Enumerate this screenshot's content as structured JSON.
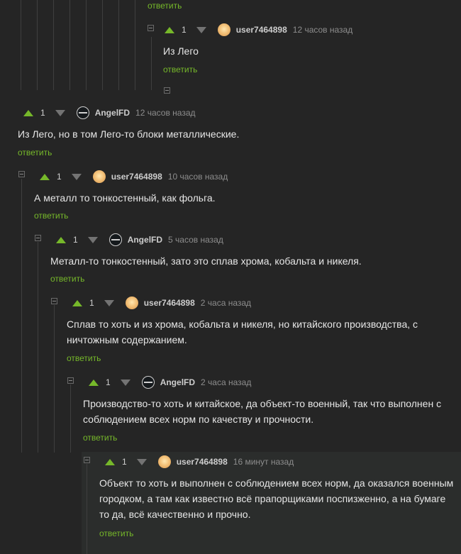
{
  "comments": [
    {
      "reply": "ответить"
    },
    {
      "score": "1",
      "user": "user7464898",
      "time": "12 часов назад",
      "text": "Из Лего",
      "reply": "ответить"
    },
    {
      "score": "1",
      "user": "AngelFD",
      "time": "12 часов назад",
      "text": "Из Лего, но в том Лего-то блоки металлические.",
      "reply": "ответить"
    },
    {
      "score": "1",
      "user": "user7464898",
      "time": "10 часов назад",
      "text": "А металл то тонкостенный, как фольга.",
      "reply": "ответить"
    },
    {
      "score": "1",
      "user": "AngelFD",
      "time": "5 часов назад",
      "text": "Металл-то тонкостенный, зато это сплав хрома, кобальта и никеля.",
      "reply": "ответить"
    },
    {
      "score": "1",
      "user": "user7464898",
      "time": "2 часа назад",
      "text_lines": [
        "Сплав то хоть и из хрома, кобальта и никеля, но китайского производства, с",
        "ничтожным содержанием."
      ],
      "reply": "ответить"
    },
    {
      "score": "1",
      "user": "AngelFD",
      "time": "2 часа назад",
      "text_lines": [
        "Производство-то хоть и китайское, да объект-то военный, так что выполнен с",
        "соблюдением всех норм по качеству и прочности."
      ],
      "reply": "ответить"
    },
    {
      "score": "1",
      "user": "user7464898",
      "time": "16 минут назад",
      "text_lines": [
        "Объект то хоть и выполнен с соблюдением всех норм, да оказался военным",
        "городком, а там как известно всё прапорщиками поспизженно, а на бумаге",
        "то да, всё качественно и прочно."
      ],
      "reply": "ответить"
    }
  ],
  "colors": {
    "accent": "#76b82a",
    "background": "#252525",
    "text": "#e6e6e6",
    "muted": "#8d8d8d"
  }
}
